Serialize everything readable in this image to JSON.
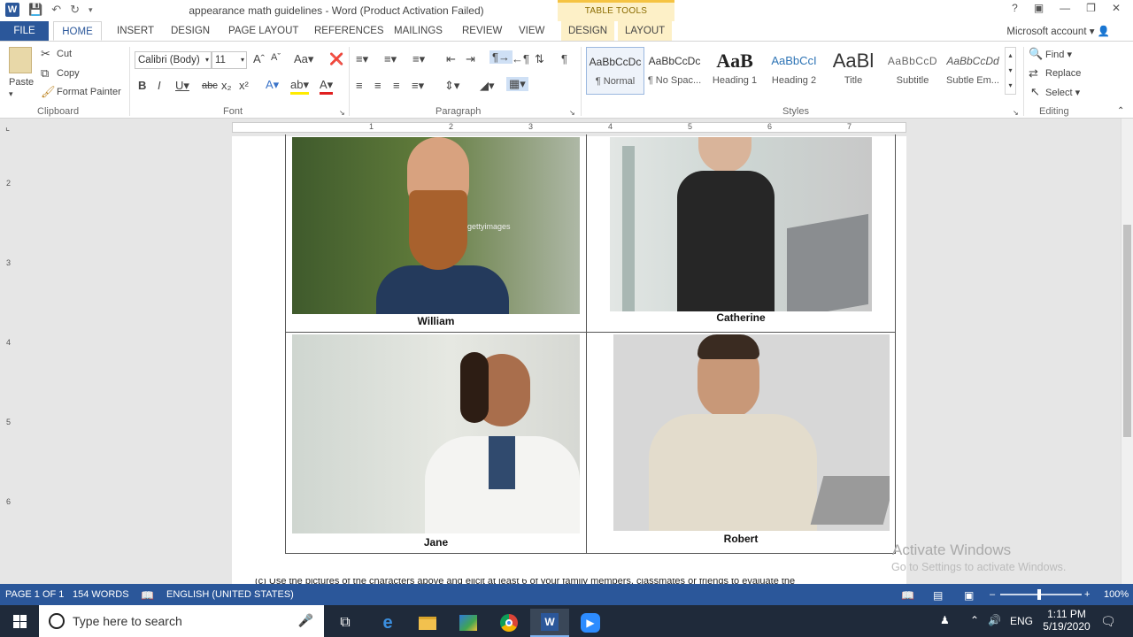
{
  "window": {
    "title": "appearance math guidelines - Word (Product Activation Failed)",
    "table_tools_header": "TABLE TOOLS",
    "help": "?",
    "account": "Microsoft account"
  },
  "tabs": [
    "FILE",
    "HOME",
    "INSERT",
    "DESIGN",
    "PAGE LAYOUT",
    "REFERENCES",
    "MAILINGS",
    "REVIEW",
    "VIEW",
    "DESIGN",
    "LAYOUT"
  ],
  "ribbon": {
    "clipboard": {
      "label": "Clipboard",
      "paste": "Paste",
      "cut": "Cut",
      "copy": "Copy",
      "format_painter": "Format Painter"
    },
    "font": {
      "label": "Font",
      "family": "Calibri (Body)",
      "size": "11"
    },
    "paragraph": {
      "label": "Paragraph"
    },
    "styles": {
      "label": "Styles",
      "items": [
        {
          "sample": "AaBbCcDc",
          "name": "¶ Normal"
        },
        {
          "sample": "AaBbCcDc",
          "name": "¶ No Spac..."
        },
        {
          "sample": "AaB",
          "name": "Heading 1"
        },
        {
          "sample": "AaBbCcI",
          "name": "Heading 2"
        },
        {
          "sample": "AaBl",
          "name": "Title"
        },
        {
          "sample": "AaBbCcD",
          "name": "Subtitle"
        },
        {
          "sample": "AaBbCcDd",
          "name": "Subtle Em..."
        }
      ]
    },
    "editing": {
      "label": "Editing",
      "find": "Find",
      "replace": "Replace",
      "select": "Select"
    }
  },
  "ruler": {
    "marks": [
      "1",
      "2",
      "3",
      "4",
      "5",
      "6",
      "7"
    ],
    "vmarks": [
      "2",
      "3",
      "4",
      "5",
      "6"
    ]
  },
  "document": {
    "people": [
      {
        "name": "William"
      },
      {
        "name": "Catherine"
      },
      {
        "name": "Jane"
      },
      {
        "name": "Robert"
      }
    ],
    "watermark_text": "gettyimages",
    "next_line": "(c)  Use the pictures of the characters above and elicit at least 6 of your family members, classmates or friends to evaluate the"
  },
  "activation": {
    "line1": "Activate Windows",
    "line2": "Go to Settings to activate Windows."
  },
  "status": {
    "page": "PAGE 1 OF 1",
    "words": "154 WORDS",
    "language": "ENGLISH (UNITED STATES)",
    "zoom": "100%"
  },
  "taskbar": {
    "search_placeholder": "Type here to search",
    "language": "ENG",
    "time": "1:11 PM",
    "date": "5/19/2020"
  }
}
